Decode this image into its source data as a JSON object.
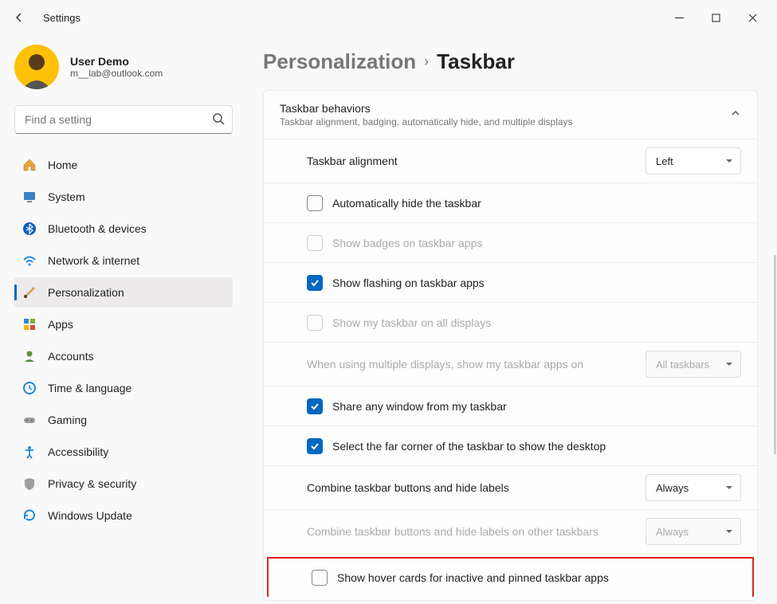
{
  "window": {
    "title": "Settings"
  },
  "user": {
    "name": "User Demo",
    "email": "m__lab@outlook.com"
  },
  "search": {
    "placeholder": "Find a setting"
  },
  "nav": [
    {
      "id": "home",
      "label": "Home"
    },
    {
      "id": "system",
      "label": "System"
    },
    {
      "id": "bluetooth",
      "label": "Bluetooth & devices"
    },
    {
      "id": "network",
      "label": "Network & internet"
    },
    {
      "id": "personalization",
      "label": "Personalization",
      "active": true
    },
    {
      "id": "apps",
      "label": "Apps"
    },
    {
      "id": "accounts",
      "label": "Accounts"
    },
    {
      "id": "time",
      "label": "Time & language"
    },
    {
      "id": "gaming",
      "label": "Gaming"
    },
    {
      "id": "accessibility",
      "label": "Accessibility"
    },
    {
      "id": "privacy",
      "label": "Privacy & security"
    },
    {
      "id": "update",
      "label": "Windows Update"
    }
  ],
  "breadcrumb": {
    "parent": "Personalization",
    "current": "Taskbar"
  },
  "section": {
    "title": "Taskbar behaviors",
    "subtitle": "Taskbar alignment, badging, automatically hide, and multiple displays"
  },
  "rows": {
    "alignment": {
      "label": "Taskbar alignment",
      "value": "Left"
    },
    "autohide": {
      "label": "Automatically hide the taskbar",
      "checked": false
    },
    "badges": {
      "label": "Show badges on taskbar apps",
      "checked": false,
      "disabled": true
    },
    "flashing": {
      "label": "Show flashing on taskbar apps",
      "checked": true
    },
    "alldisplays": {
      "label": "Show my taskbar on all displays",
      "checked": false,
      "disabled": true
    },
    "multidisp": {
      "label": "When using multiple displays, show my taskbar apps on",
      "value": "All taskbars",
      "disabled": true
    },
    "share": {
      "label": "Share any window from my taskbar",
      "checked": true
    },
    "farcorner": {
      "label": "Select the far corner of the taskbar to show the desktop",
      "checked": true
    },
    "combine": {
      "label": "Combine taskbar buttons and hide labels",
      "value": "Always"
    },
    "combineother": {
      "label": "Combine taskbar buttons and hide labels on other taskbars",
      "value": "Always",
      "disabled": true
    },
    "hovercards": {
      "label": "Show hover cards for inactive and pinned taskbar apps",
      "checked": false
    }
  }
}
